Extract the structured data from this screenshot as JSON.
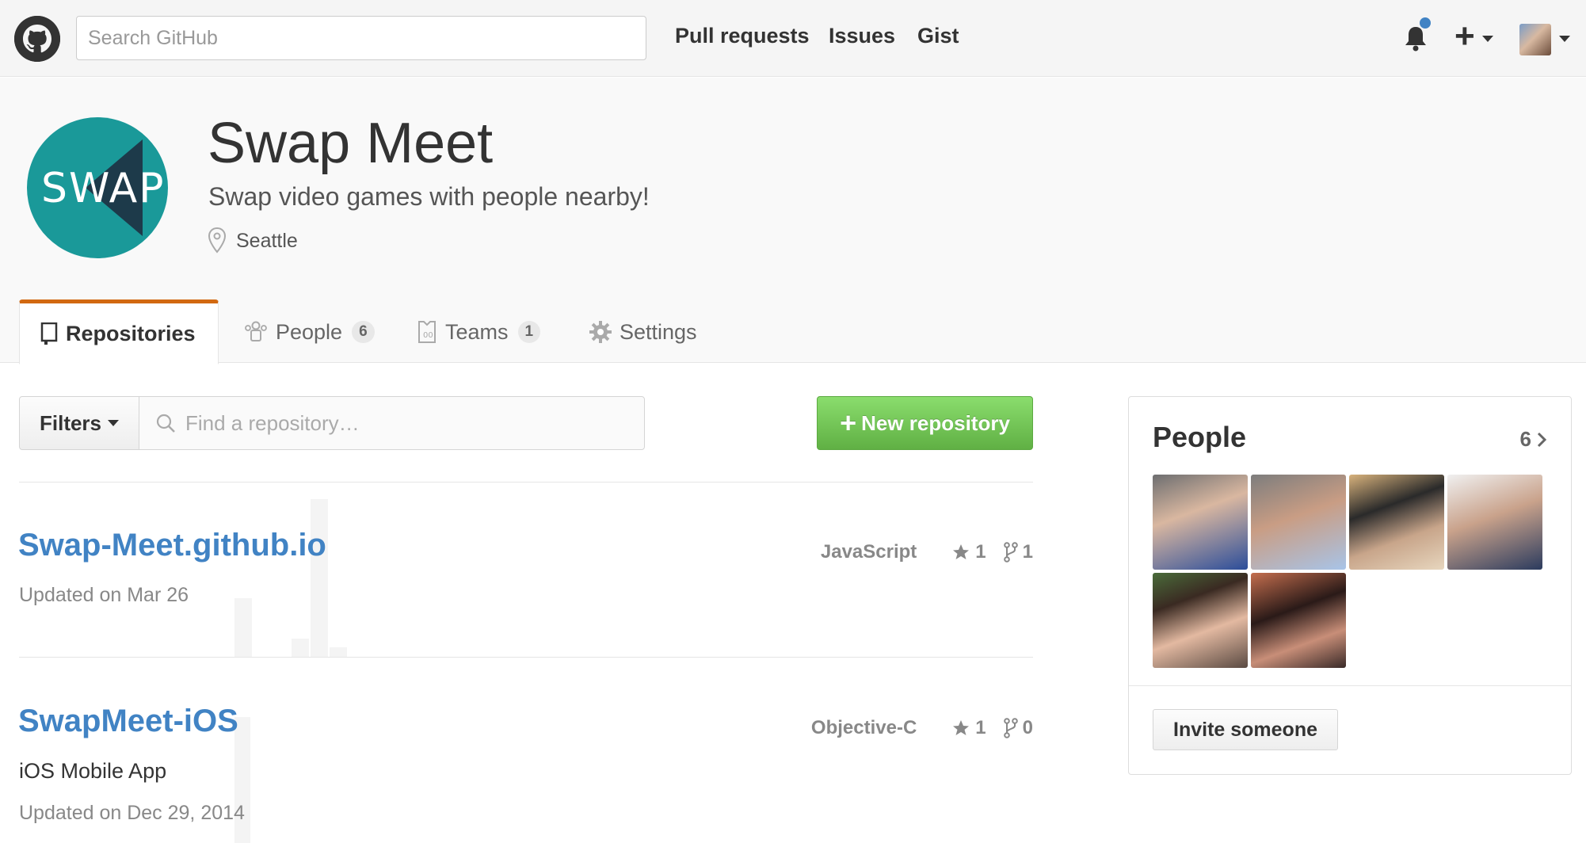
{
  "header": {
    "search_placeholder": "Search GitHub",
    "nav": [
      "Pull requests",
      "Issues",
      "Gist"
    ]
  },
  "org": {
    "logo_text": "SWAP",
    "name": "Swap Meet",
    "description": "Swap video games with people nearby!",
    "location": "Seattle"
  },
  "tabs": {
    "repositories": "Repositories",
    "people": "People",
    "people_count": "6",
    "teams": "Teams",
    "teams_count": "1",
    "settings": "Settings"
  },
  "toolbar": {
    "filters_label": "Filters",
    "find_placeholder": "Find a repository…",
    "new_repo_label": "New repository"
  },
  "repos": [
    {
      "name": "Swap-Meet.github.io",
      "language": "JavaScript",
      "stars": "1",
      "forks": "1",
      "description": "",
      "updated": "Updated on Mar 26"
    },
    {
      "name": "SwapMeet-iOS",
      "language": "Objective-C",
      "stars": "1",
      "forks": "0",
      "description": "iOS Mobile App",
      "updated": "Updated on Dec 29, 2014"
    }
  ],
  "people_panel": {
    "title": "People",
    "count": "6",
    "invite_label": "Invite someone"
  },
  "colors": {
    "link": "#4183c4",
    "tab_accent": "#d26911",
    "new_repo_green": "#60b044",
    "org_teal": "#1a9999",
    "org_dark": "#1d3a4a"
  }
}
